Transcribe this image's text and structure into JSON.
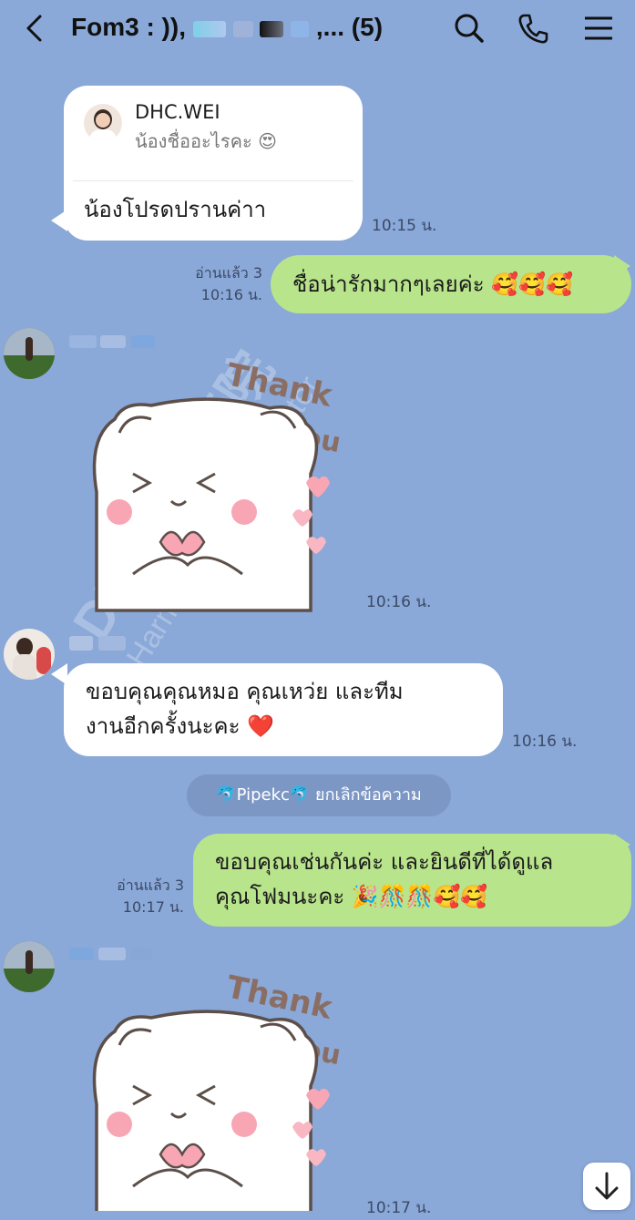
{
  "header": {
    "title_prefix": "Fom3 : )),",
    "title_suffix": ",... (5)",
    "back_icon": "chevron-left-icon",
    "search_icon": "search-icon",
    "call_icon": "phone-icon",
    "menu_icon": "hamburger-menu-icon"
  },
  "messages": {
    "m1": {
      "reply_sender": "DHC.WEI",
      "reply_text": "น้องชื่ออะไรคะ 😍",
      "text": "น้องโปรดปรานค่าา",
      "time": "10:15 น."
    },
    "m2": {
      "read": "อ่านแล้ว 3",
      "time": "10:16 น.",
      "text": "ชื่อน่ารักมากๆเลยค่ะ 🥰🥰🥰"
    },
    "m3": {
      "sticker_text_1": "Thank",
      "sticker_text_2": "you",
      "time": "10:16 น."
    },
    "m4": {
      "line1": "ขอบคุณคุณหมอ คุณเหว่ย และทีม",
      "line2": "งานอีกครั้งนะคะ ❤️",
      "time": "10:16 น."
    },
    "system": {
      "text": "🐬Pipekc🐬 ยกเลิกข้อความ"
    },
    "m5": {
      "read": "อ่านแล้ว 3",
      "time": "10:17 น.",
      "line1": "ขอบคุณเช่นกันค่ะ และยินดีที่ได้ดูแล",
      "line2": "คุณโฟมนะคะ 🎉🎊🎊🥰🥰"
    },
    "m6": {
      "sticker_text_1": "Thank",
      "sticker_text_2": "you",
      "time": "10:17 น."
    }
  },
  "watermark": {
    "line1": "DHC生殖医院",
    "line2": "Harmonicare IVF Center"
  },
  "colors": {
    "background": "#8aa8d8",
    "bubble_white": "#ffffff",
    "bubble_green": "#b8e48c"
  }
}
